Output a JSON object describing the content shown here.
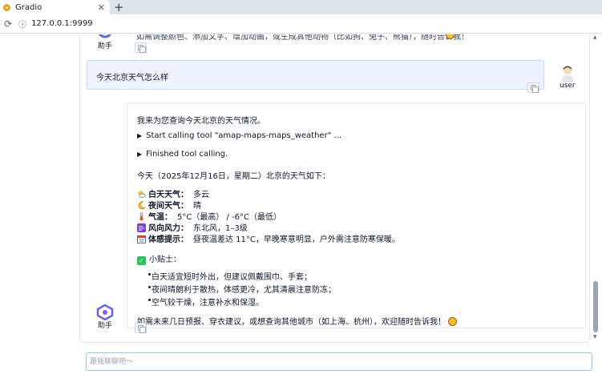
{
  "browser": {
    "tab_title": "Gradio",
    "tab_close": "✕",
    "new_tab": "+",
    "url": "127.0.0.1:9999"
  },
  "chat": {
    "previous_message": "如需调整颜色、添加文字、增加动画，或生成其他动物（比如狗、兔子、熊猫），随时告诉我！",
    "assistant_label": "助手",
    "user_label": "user",
    "user_message": "今天北京天气怎么样",
    "bot_message": {
      "intro": "我来为您查询今天北京的天气情况。",
      "tool_call": "Start calling tool \"amap-maps-maps_weather\" ...",
      "tool_done": "Finished tool calling.",
      "summary": "今天（2025年12月16日，星期二）北京的天气如下：",
      "weather": [
        {
          "icon": "partly-cloudy-icon",
          "label": "白天天气：",
          "value": "多云"
        },
        {
          "icon": "moon-icon",
          "label": "夜间天气：",
          "value": "晴"
        },
        {
          "icon": "thermometer-icon",
          "label": "气温：",
          "value": "5°C（最高） / -6°C（最低）"
        },
        {
          "icon": "wind-icon",
          "label": "风向风力：",
          "value": "东北风，1–3级"
        },
        {
          "icon": "calendar-icon",
          "label": "体感提示：",
          "value": "昼夜温差达 11°C，早晚寒意明显，户外需注意防寒保暖。"
        }
      ],
      "tips_title": "小贴士：",
      "tips": [
        "白天适宜短时外出，但建议佩戴围巾、手套；",
        "夜间晴朗利于散热，体感更冷，尤其清晨注意防冻；",
        "空气较干燥，注意补水和保湿。"
      ],
      "closing": "如需未来几日预报、穿衣建议，或想查询其他城市（如上海、杭州），欢迎随时告诉我！"
    }
  },
  "input": {
    "placeholder": "跟我聊聊吧～"
  },
  "colors": {
    "user_bubble": "#eef4ff",
    "user_border": "#bfdbfe",
    "accent": "#3b82f6"
  }
}
